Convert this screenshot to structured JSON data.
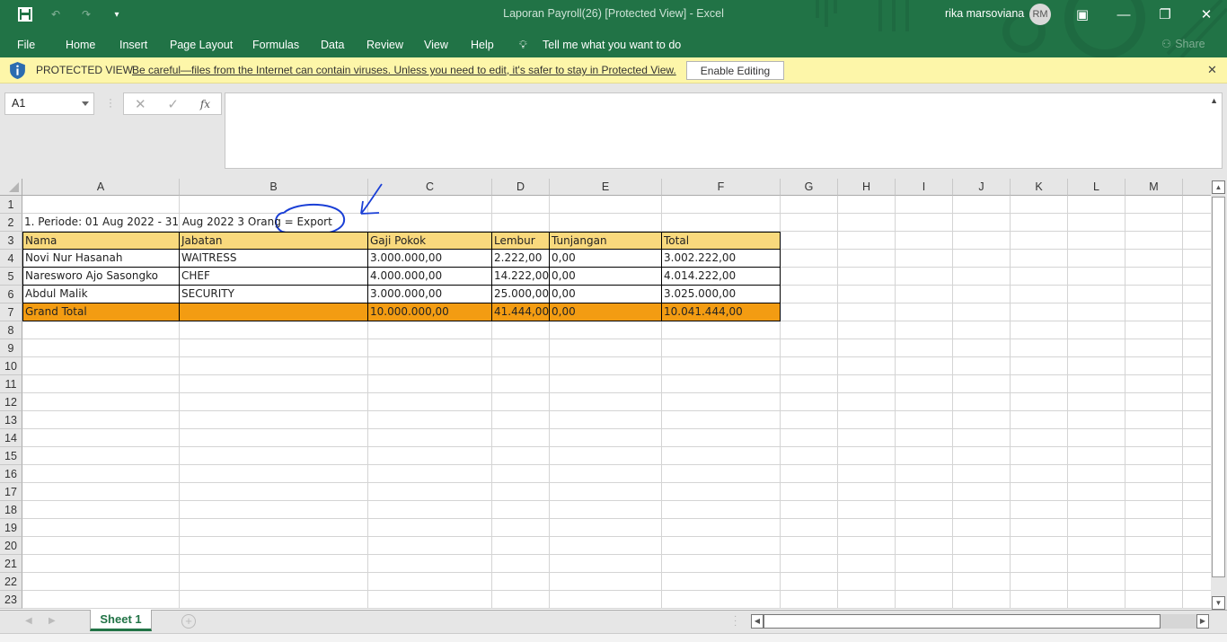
{
  "window": {
    "title": "Laporan Payroll(26)  [Protected View]  -  Excel",
    "user_name": "rika marsoviana",
    "user_initials": "RM",
    "accent_color": "#217346"
  },
  "quick_access": {
    "icons": [
      "save-icon",
      "undo-icon",
      "redo-icon",
      "customize-icon"
    ]
  },
  "menu": {
    "items": [
      "File",
      "Home",
      "Insert",
      "Page Layout",
      "Formulas",
      "Data",
      "Review",
      "View",
      "Help"
    ],
    "tell_me": "Tell me what you want to do",
    "share": "Share"
  },
  "protected_view": {
    "label": "PROTECTED VIEW",
    "message": "Be careful—files from the Internet can contain viruses. Unless you need to edit, it's safer to stay in Protected View.",
    "button": "Enable Editing",
    "close": "✕"
  },
  "formula_bar": {
    "name_box": "A1",
    "cancel": "✕",
    "enter": "✓",
    "fx": "fx",
    "formula": ""
  },
  "columns": [
    "A",
    "B",
    "C",
    "D",
    "E",
    "F",
    "G",
    "H",
    "I",
    "J",
    "K",
    "L",
    "M"
  ],
  "rows": [
    "1",
    "2",
    "3",
    "4",
    "5",
    "6",
    "7",
    "8",
    "9",
    "10",
    "11",
    "12",
    "13",
    "14",
    "15",
    "16",
    "17",
    "18",
    "19",
    "20",
    "21",
    "22",
    "23"
  ],
  "sheet": {
    "row2_text": "1. Periode: 01 Aug 2022 - 31 Aug 2022  3 Orang  =  Export",
    "headers": [
      "Nama",
      "Jabatan",
      "Gaji Pokok",
      "Lembur",
      "Tunjangan",
      "Total"
    ],
    "records": [
      [
        "Novi Nur Hasanah",
        "WAITRESS",
        "3.000.000,00",
        "2.222,00",
        "0,00",
        "3.002.222,00"
      ],
      [
        "Naresworo Ajo Sasongko",
        "CHEF",
        "4.000.000,00",
        "14.222,00",
        "0,00",
        "4.014.222,00"
      ],
      [
        "Abdul Malik",
        "SECURITY",
        "3.000.000,00",
        "25.000,00",
        "0,00",
        "3.025.000,00"
      ]
    ],
    "grand_total": [
      "Grand Total",
      "",
      "10.000.000,00",
      "41.444,00",
      "0,00",
      "10.041.444,00"
    ],
    "header_color": "#f9d97d",
    "total_color": "#f39c12"
  },
  "tabs": {
    "active": "Sheet 1",
    "add": "+"
  }
}
